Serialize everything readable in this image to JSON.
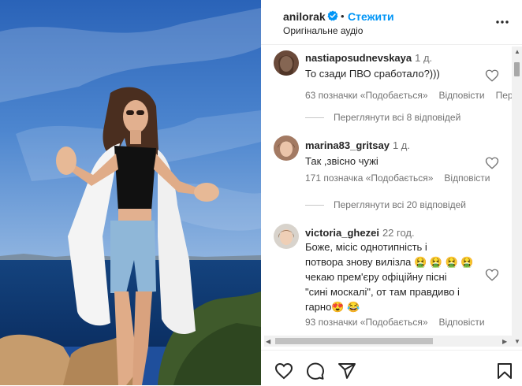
{
  "header": {
    "username": "anilorak",
    "follow_label": "Стежити",
    "separator": "•",
    "audio": "Оригінальне аудіо"
  },
  "comments": [
    {
      "username": "nastiaposudnevskaya",
      "time": "1 д.",
      "text": "То сзади ПВО сработало?)))",
      "likes": "63 позначки «Подобається»",
      "reply_label": "Відповісти",
      "extra": "Пер",
      "view_replies": "Переглянути всі 8 відповідей"
    },
    {
      "username": "marina83_gritsay",
      "time": "1 д.",
      "text": "Так ,звісно чужі",
      "likes": "171 позначка «Подобається»",
      "reply_label": "Відповісти",
      "view_replies": "Переглянути всі 20 відповідей"
    },
    {
      "username": "victoria_ghezei",
      "time": "22 год.",
      "text_lines": [
        "Боже, місіс однотипність і",
        "потвора знову вилізла 🤮 🤮 🤮 🤮",
        "чекаю прем'єру офіційну пісні",
        "\"сині москалі\", от там правдиво і",
        "гарно😍 😂"
      ],
      "likes": "93 позначки «Подобається»",
      "reply_label": "Відповісти"
    }
  ],
  "icons": {
    "verified": "verified-badge-icon",
    "more": "more-options-icon",
    "like": "heart-icon",
    "comment": "comment-icon",
    "share": "share-icon",
    "save": "bookmark-icon"
  },
  "colors": {
    "accent": "#0095f6",
    "text": "#262626",
    "muted": "#737373"
  }
}
